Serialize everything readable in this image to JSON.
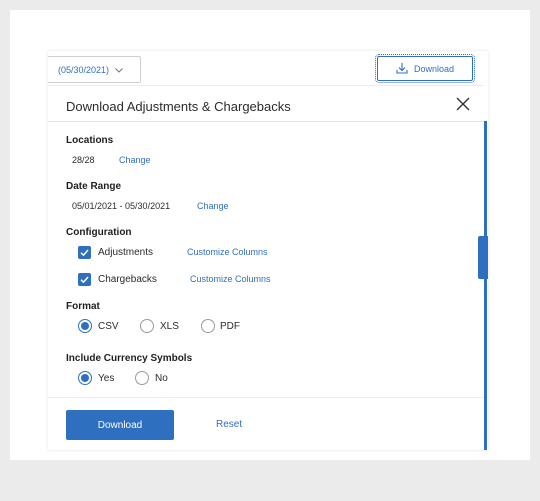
{
  "toolbar": {
    "date_range_value": "(05/30/2021)",
    "download_label": "Download"
  },
  "dialog": {
    "title": "Download Adjustments & Chargebacks",
    "locations": {
      "heading": "Locations",
      "value": "28/28",
      "change_label": "Change"
    },
    "date_range": {
      "heading": "Date Range",
      "value": "05/01/2021 - 05/30/2021",
      "change_label": "Change"
    },
    "configuration": {
      "heading": "Configuration",
      "items": [
        {
          "label": "Adjustments",
          "checked": true,
          "action": "Customize Columns"
        },
        {
          "label": "Chargebacks",
          "checked": true,
          "action": "Customize Columns"
        }
      ]
    },
    "format": {
      "heading": "Format",
      "options": [
        "CSV",
        "XLS",
        "PDF"
      ],
      "selected": "CSV"
    },
    "currency": {
      "heading": "Include Currency Symbols",
      "options": [
        "Yes",
        "No"
      ],
      "selected": "Yes"
    },
    "download_label": "Download",
    "reset_label": "Reset"
  },
  "colors": {
    "accent": "#2f6fc0",
    "page_bg": "#ebebeb"
  }
}
